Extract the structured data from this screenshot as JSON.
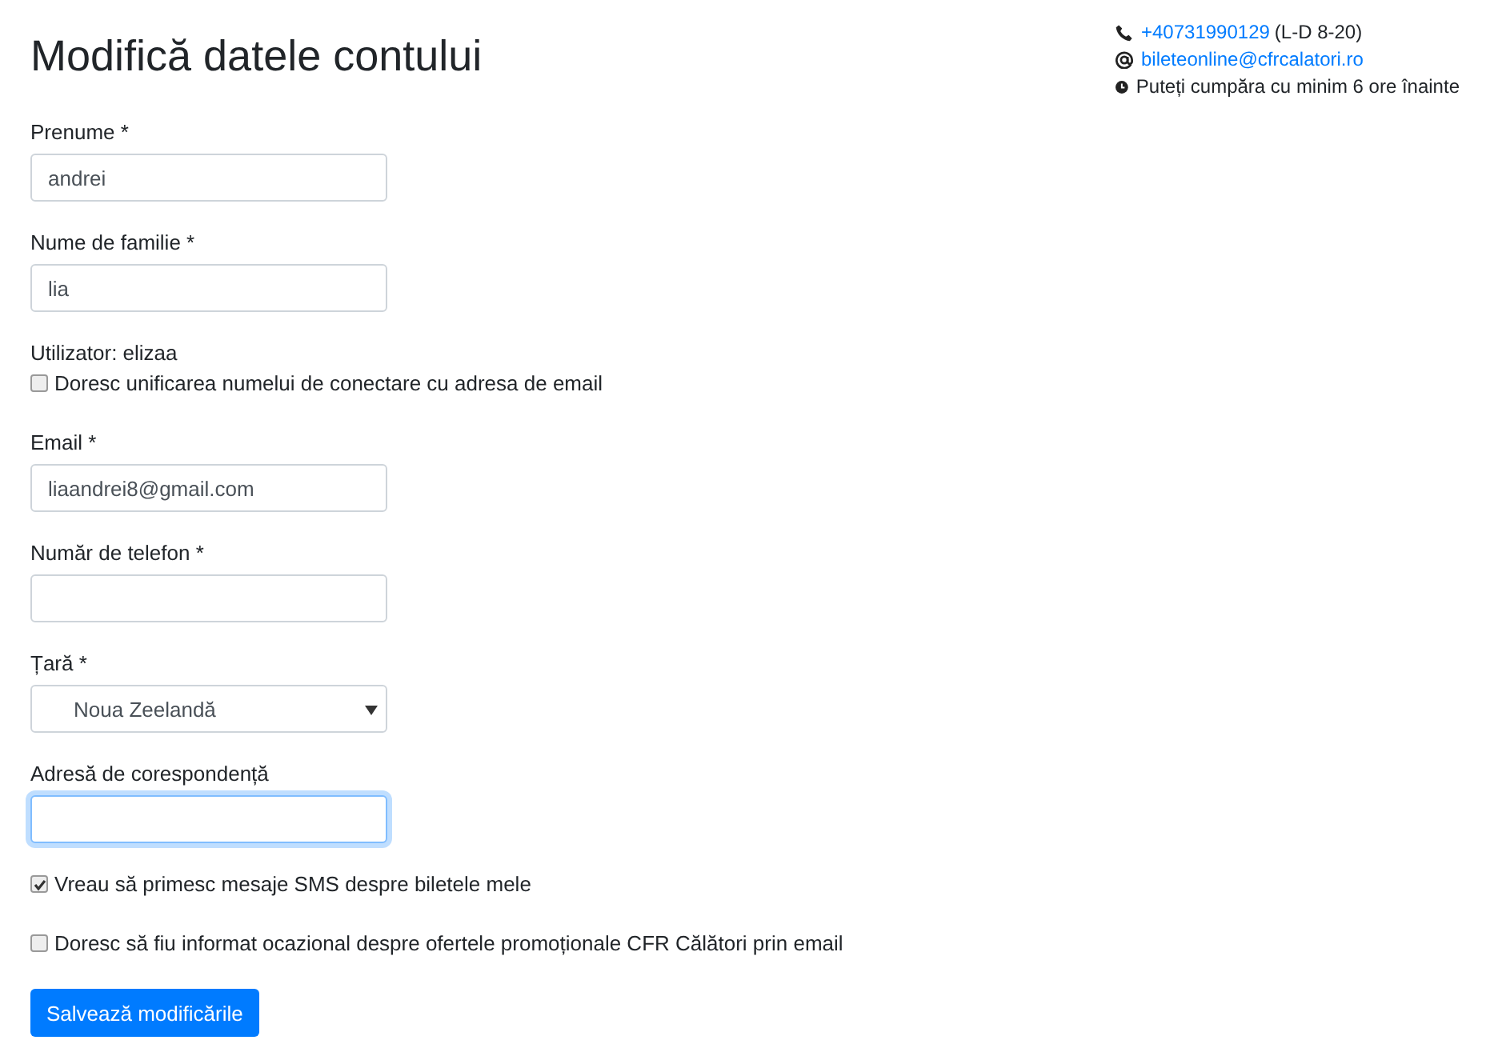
{
  "title": "Modifică datele contului",
  "contact": [
    {
      "kind": "phone",
      "link": "+40731990129",
      "note": "(L-D 8-20)"
    },
    {
      "kind": "email",
      "link": "bileteonline@cfrcalatori.ro"
    },
    {
      "kind": "clock",
      "text": "Puteți cumpăra cu minim 6 ore înainte"
    }
  ],
  "form": [
    {
      "kind": "input",
      "label": "Prenume *",
      "value": "andrei",
      "focused": false
    },
    {
      "kind": "input",
      "label": "Nume de familie *",
      "value": "lia",
      "focused": false
    },
    {
      "kind": "text",
      "text": "Utilizator: elizaa"
    },
    {
      "kind": "checkbox",
      "label": "Doresc unificarea numelui de conectare cu adresa de email",
      "checked": false
    },
    {
      "kind": "input",
      "label": "Email *",
      "value": "liaandrei8@gmail.com",
      "focused": false
    },
    {
      "kind": "input",
      "label": "Număr de telefon *",
      "focused": false
    },
    {
      "kind": "select",
      "label": "Țară *",
      "value": "Noua Zeelandă",
      "focused": false
    },
    {
      "kind": "input",
      "label": "Adresă de corespondență",
      "focused": true
    },
    {
      "kind": "checkbox",
      "label": "Vreau să primesc mesaje SMS despre biletele mele",
      "checked": true
    },
    {
      "kind": "checkbox",
      "label": "Doresc să fiu informat ocazional despre ofertele promoționale CFR Călători prin email",
      "checked": false
    }
  ],
  "button": "Salvează modificările"
}
